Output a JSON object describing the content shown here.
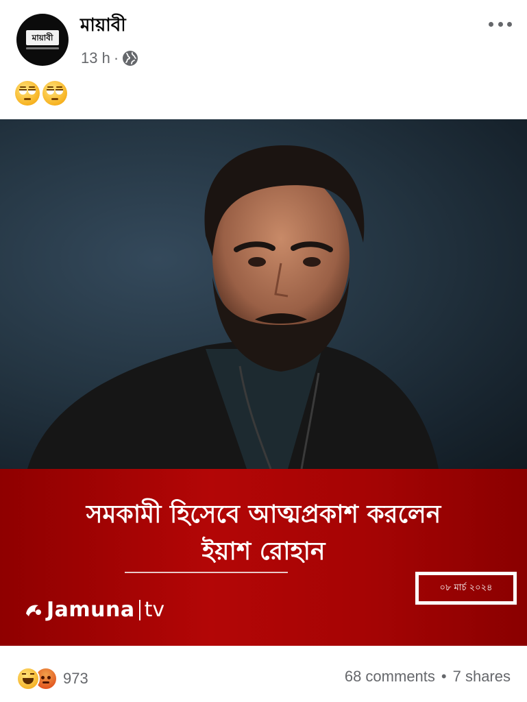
{
  "post": {
    "page_name": "মায়াবী",
    "avatar_logo_text": "মায়াবী",
    "time": "13 h",
    "meta_separator": "·",
    "audience_icon": "globe-icon",
    "more_icon": "more-options-icon",
    "caption_emojis": [
      "face-with-rolling-eyes-emoji",
      "face-with-rolling-eyes-emoji"
    ]
  },
  "image": {
    "headline_line1": "সমকামী হিসেবে আত্মপ্রকাশ করলেন",
    "headline_line2": "ইয়াশ রোহান",
    "brand_name": "Jamuna",
    "brand_tv": "tv",
    "date": "০৮ মার্চ ২০২৪",
    "banner_color": "#a50404"
  },
  "footer": {
    "reaction_icons": [
      "haha-reaction-icon",
      "angry-reaction-icon"
    ],
    "reaction_count": "973",
    "comments": "68 comments",
    "separator": "•",
    "shares": "7 shares"
  }
}
